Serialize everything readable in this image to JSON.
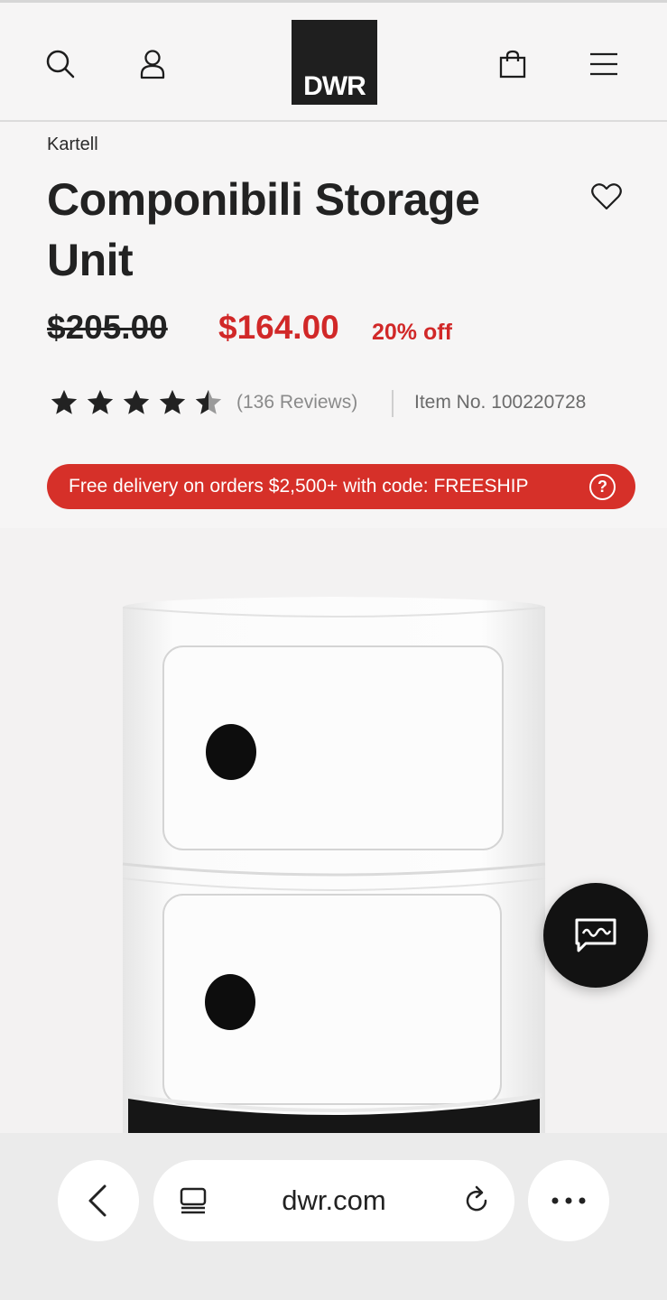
{
  "header": {
    "logo_text": "DWR",
    "icons": [
      "search-icon",
      "account-icon",
      "shopping-bag-icon",
      "menu-icon"
    ]
  },
  "product": {
    "brand": "Kartell",
    "title": "Componibili Storage Unit",
    "original_price": "$205.00",
    "sale_price": "$164.00",
    "discount": "20% off",
    "rating": 4.5,
    "rating_max": 5,
    "reviews_label": "(136 Reviews)",
    "item_number": "Item No. 100220728"
  },
  "promo": {
    "text": "Free delivery on orders $2,500+ with code: FREESHIP",
    "help_glyph": "?"
  },
  "browser": {
    "url": "dwr.com"
  },
  "colors": {
    "sale_red": "#d12828",
    "promo_red": "#d63029",
    "logo_bg": "#1f1f1f",
    "chat_bg": "#121212"
  }
}
